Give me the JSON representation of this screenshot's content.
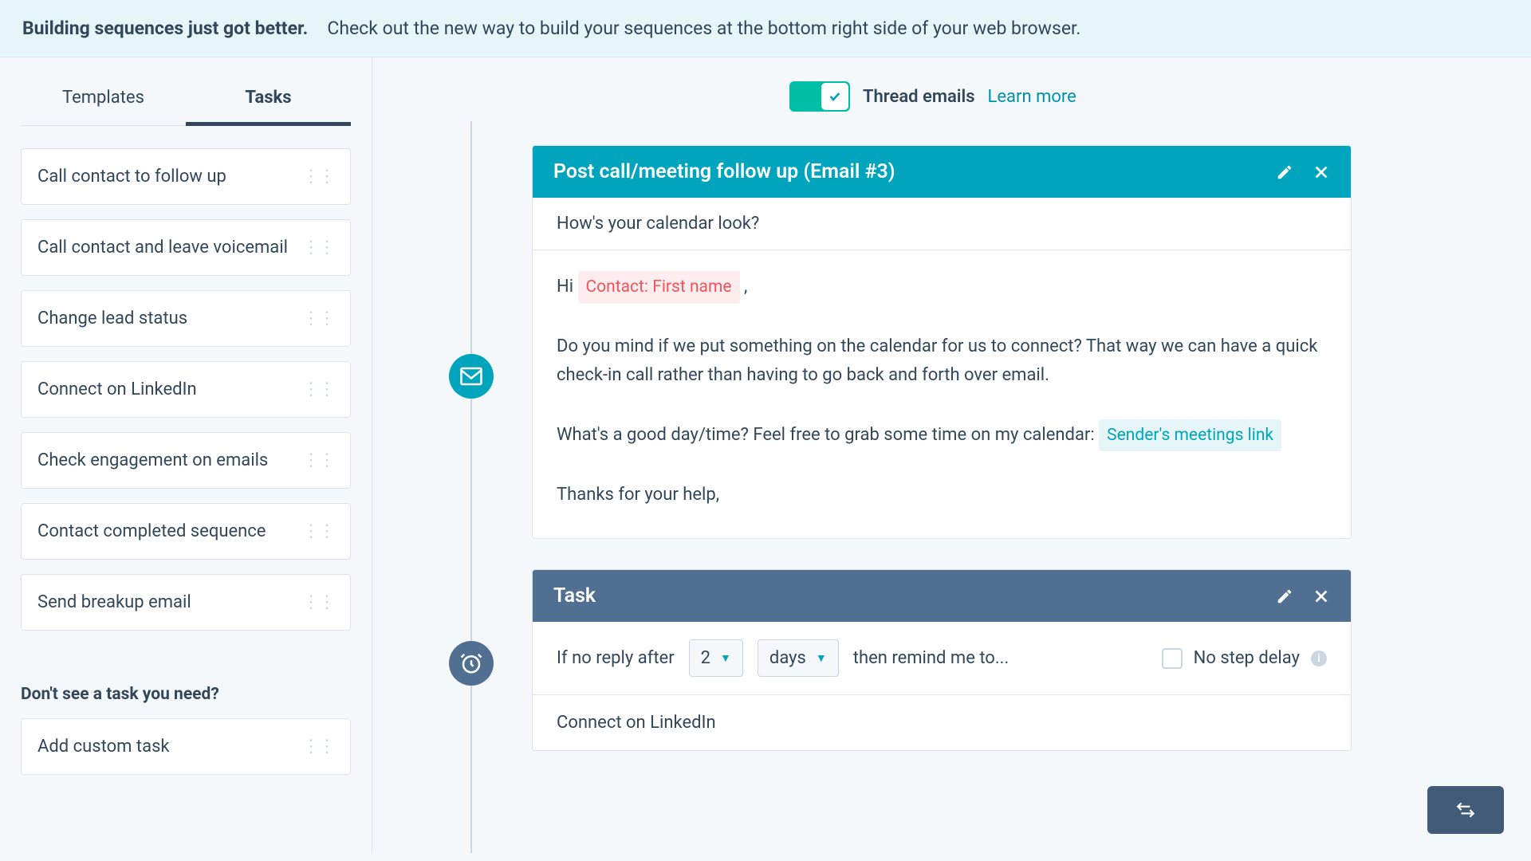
{
  "banner": {
    "title": "Building sequences just got better.",
    "text": "Check out the new way to build your sequences at the bottom right side of your web browser."
  },
  "sidebar": {
    "tabs": {
      "templates": "Templates",
      "tasks": "Tasks"
    },
    "items": [
      "Call contact to follow up",
      "Call contact and leave voicemail",
      "Change lead status",
      "Connect on LinkedIn",
      "Check engagement on emails",
      "Contact completed sequence",
      "Send breakup email"
    ],
    "hint": "Don't see a task you need?",
    "add_custom": "Add custom task"
  },
  "thread": {
    "label": "Thread emails",
    "learn": "Learn more"
  },
  "email_card": {
    "title": "Post call/meeting follow up (Email #3)",
    "subject": "How's your calendar look?",
    "greeting_pre": "Hi ",
    "token_contact": "Contact: First name",
    "greeting_post": " ,",
    "para1": " Do you mind if we put something on the calendar for us to connect? That way we can have a quick check-in call rather than having to go back and forth over email.",
    "para2_pre": " What's a good day/time? Feel free to grab some time on my calendar:  ",
    "token_meeting": "Sender's meetings link",
    "para3": "Thanks for your help,"
  },
  "task_card": {
    "title": "Task",
    "if_no_reply": "If no reply after",
    "qty": "2",
    "unit": "days",
    "remind": "then remind me to...",
    "no_delay": "No step delay",
    "task_text": "Connect on LinkedIn"
  }
}
